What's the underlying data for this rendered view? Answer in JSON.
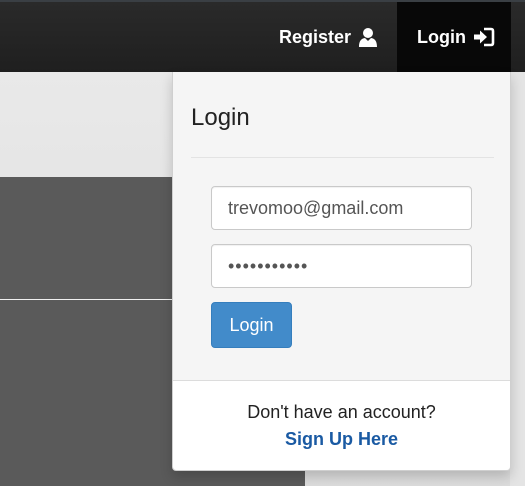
{
  "navbar": {
    "register_label": "Register",
    "register_icon": "user-icon",
    "login_label": "Login",
    "login_icon": "sign-in-icon"
  },
  "login_panel": {
    "title": "Login",
    "email_value": "trevomoo@gmail.com",
    "password_value": "•••••••••••",
    "submit_label": "Login",
    "signup_prompt": "Don't have an account?",
    "signup_link": "Sign Up Here"
  },
  "colors": {
    "navbar_bg": "#222222",
    "active_nav_bg": "#080808",
    "primary_button": "#428bca",
    "link": "#1a5aa3"
  }
}
